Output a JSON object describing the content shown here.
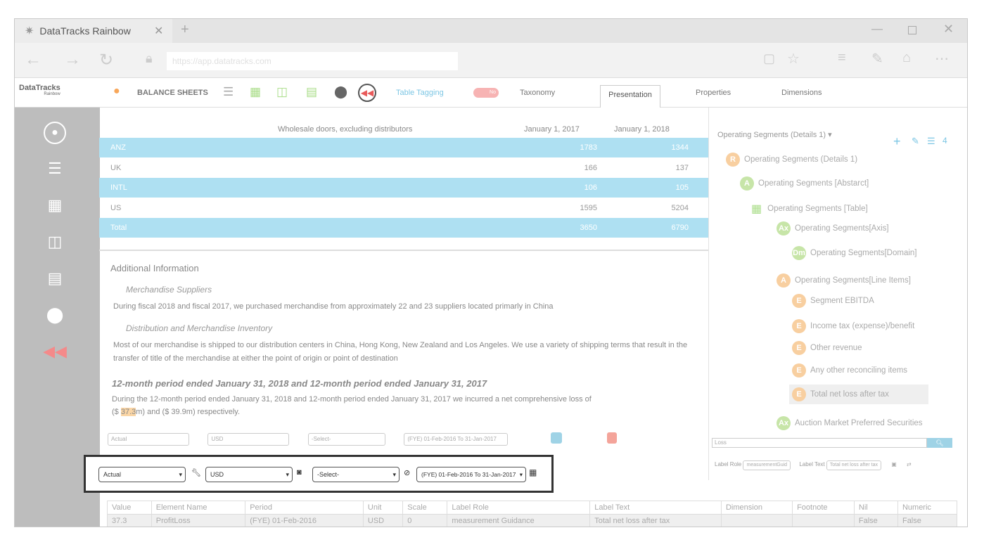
{
  "browser": {
    "tab_title": "DataTracks Rainbow",
    "url": "https://app.datatracks.com"
  },
  "app": {
    "logo": "DataTracks",
    "logo_sub": "Rainbow"
  },
  "toolbar": {
    "doc_title": "BALANCE SHEETS",
    "table_tagging": "Table Tagging",
    "toggle": "No",
    "tabs": [
      "Taxonomy",
      "Presentation",
      "Properties",
      "Dimensions"
    ],
    "active_tab": "Presentation"
  },
  "table": {
    "header_label": "Wholesale doors, excluding distributors",
    "col1": "January 1, 2017",
    "col2": "January 1, 2018",
    "rows": [
      {
        "label": "ANZ",
        "v1": "1783",
        "v2": "1344",
        "hl": true
      },
      {
        "label": "UK",
        "v1": "166",
        "v2": "137",
        "hl": false
      },
      {
        "label": "INTL",
        "v1": "106",
        "v2": "105",
        "hl": true
      },
      {
        "label": "US",
        "v1": "1595",
        "v2": "5204",
        "hl": false
      },
      {
        "label": "Total",
        "v1": "3650",
        "v2": "6790",
        "hl": true
      }
    ]
  },
  "content": {
    "section": "Additional Information",
    "h1": "Merchandise Suppliers",
    "p1": "During fiscal 2018 and fiscal 2017, we purchased merchandise from approximately 22 and 23 suppliers located primarly in China",
    "h2": "Distribution and Merchandise Inventory",
    "p2": "Most of our merchandise is shipped to our distribution centers in China, Hong Kong, New Zealand and Los Angeles. We use a variety of shipping terms that result in the transfer of title of the merchandise at either the point of origin or point of destination",
    "h3": "12-month period ended January 31, 2018 and 12-month period ended January 31, 2017",
    "p3a": "During the 12-month period ended January 31, 2018 and 12-month period ended January 31, 2017 we incurred a net comprehensive loss of",
    "p3b_pre": "($ ",
    "p3b_hl": "37.3",
    "p3b_post": "m) and ($ 39.9m) respectively."
  },
  "filters": {
    "scenario": "Actual",
    "currency": "USD",
    "select": "-Select-",
    "period": "(FYE) 01-Feb-2016 To 31-Jan-2017"
  },
  "tree": {
    "title": "Operating Segments (Details 1)",
    "count": "4",
    "nodes": [
      {
        "badge": "R",
        "label": "Operating Segments (Details 1)"
      },
      {
        "badge": "A",
        "label": "Operating Segments [Abstarct]"
      },
      {
        "badge": "",
        "label": "Operating Segments [Table]"
      },
      {
        "badge": "Ax",
        "label": "Operating Segments[Axis]"
      },
      {
        "badge": "Dm",
        "label": "Operating Segments[Domain]"
      },
      {
        "badge": "A",
        "label": "Operating Segments[Line Items]"
      },
      {
        "badge": "E",
        "label": "Segment EBITDA"
      },
      {
        "badge": "E",
        "label": "Income tax (expense)/benefit"
      },
      {
        "badge": "E",
        "label": "Other revenue"
      },
      {
        "badge": "E",
        "label": "Any other reconciling items"
      },
      {
        "badge": "E",
        "label": "Total net loss after tax"
      },
      {
        "badge": "Ax",
        "label": "Auction Market Preferred Securities"
      }
    ]
  },
  "search": {
    "value": "Loss",
    "label_role": "Label Role",
    "label_role_val": "measurementGuid",
    "label_text": "Label Text",
    "label_text_val": "Total net loss after tax"
  },
  "grid": {
    "headers": [
      "Value",
      "Element Name",
      "Period",
      "Unit",
      "Scale",
      "Label Role",
      "Label Text",
      "Dimension",
      "Footnote",
      "Nil",
      "Numeric"
    ],
    "row": [
      "37.3",
      "ProfitLoss",
      "(FYE) 01-Feb-2016",
      "USD",
      "0",
      "measurement Guidance",
      "Total net loss after tax",
      "",
      "",
      "False",
      "False"
    ]
  }
}
